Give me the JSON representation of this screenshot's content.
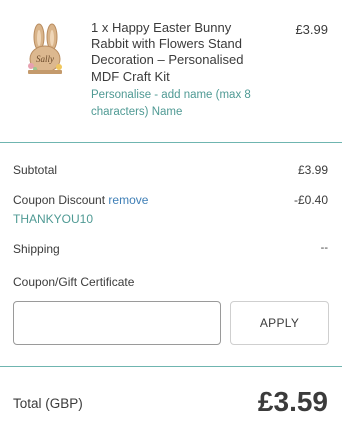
{
  "product": {
    "image_alt": "Happy Easter Bunny Rabbit with Flowers Stand Decoration",
    "image_text": "Sally",
    "name": "1 x Happy Easter Bunny Rabbit with Flowers Stand Decoration – Personalised MDF Craft Kit",
    "price": "£3.99",
    "option": "Personalise - add name (max 8 characters) Name"
  },
  "totals": {
    "subtotal_label": "Subtotal",
    "subtotal_value": "£3.99",
    "coupon_label": "Coupon Discount",
    "coupon_remove": "remove",
    "coupon_code": "THANKYOU10",
    "coupon_value": "-£0.40",
    "shipping_label": "Shipping",
    "shipping_value": "--",
    "gift_label": "Coupon/Gift Certificate",
    "input_placeholder": "",
    "apply_label": "APPLY",
    "total_label": "Total (GBP)",
    "total_value": "£3.59"
  },
  "colors": {
    "divider": "#6fb5b0",
    "option_text": "#4f9a94",
    "link": "#3f7fb6"
  }
}
